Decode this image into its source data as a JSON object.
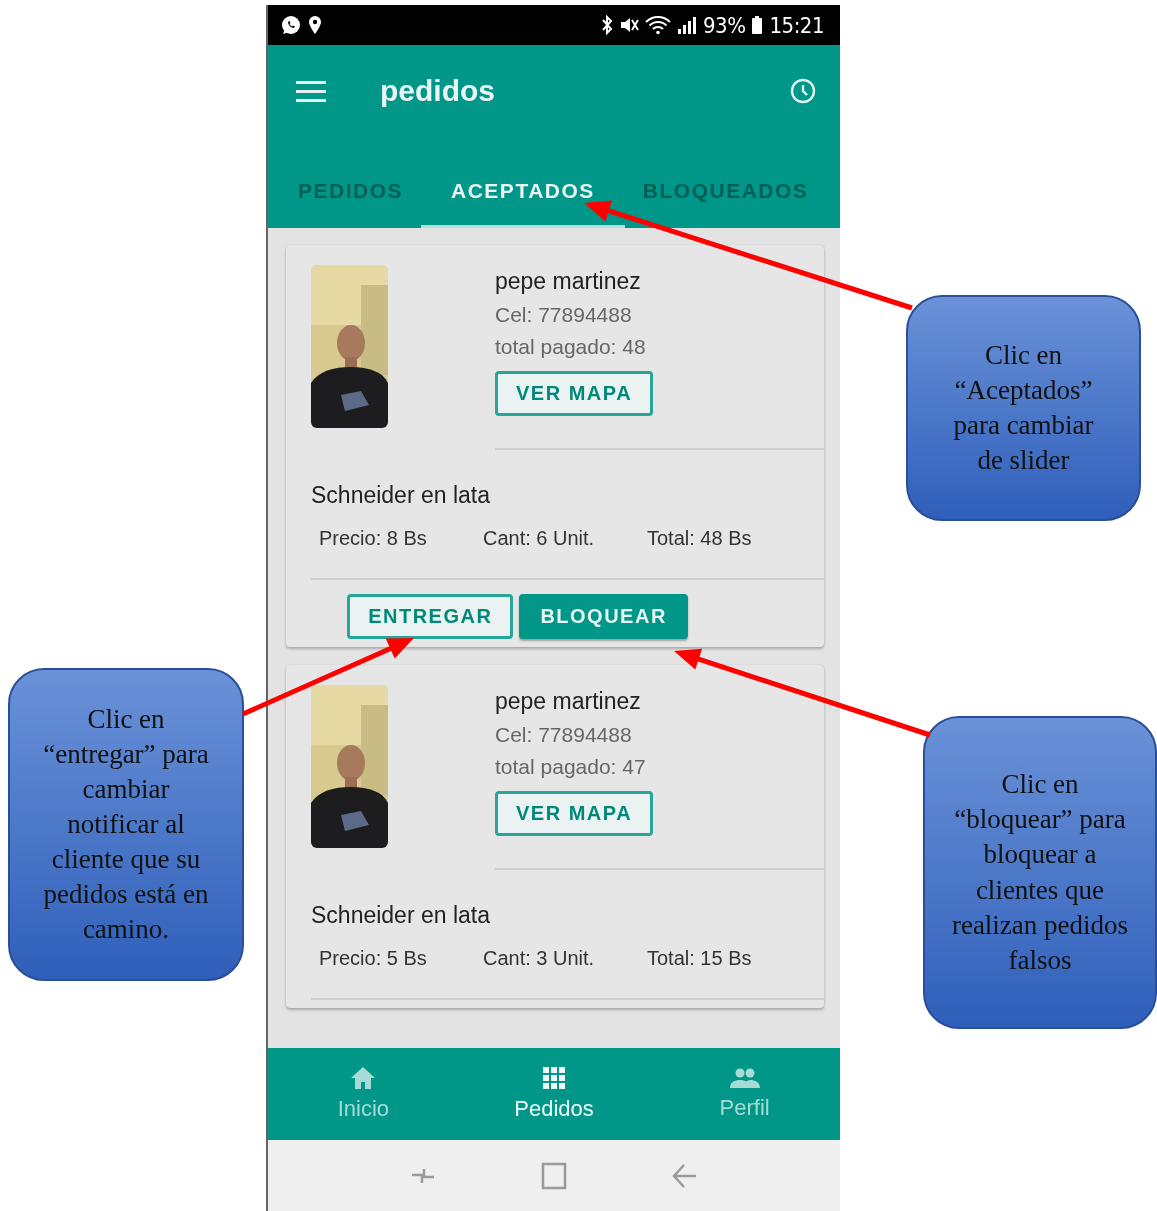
{
  "status_bar": {
    "battery": "93%",
    "time": "15:21"
  },
  "app_bar": {
    "title": "pedidos"
  },
  "tabs": [
    {
      "label": "PEDIDOS",
      "selected": false
    },
    {
      "label": "ACEPTADOS",
      "selected": true
    },
    {
      "label": "BLOQUEADOS",
      "selected": false
    }
  ],
  "orders": [
    {
      "name": "pepe martinez",
      "phone": "Cel: 77894488",
      "paid": "total pagado: 48",
      "map_button": "VER MAPA",
      "items": [
        {
          "product": "Schneider en lata",
          "price": "Precio: 8 Bs",
          "qty": "Cant: 6 Unit.",
          "total": "Total: 48 Bs"
        }
      ],
      "actions": [
        {
          "label": "ENTREGAR",
          "kind": "outlined"
        },
        {
          "label": "BLOQUEAR",
          "kind": "filled"
        }
      ]
    },
    {
      "name": "pepe martinez",
      "phone": "Cel: 77894488",
      "paid": "total pagado: 47",
      "map_button": "VER MAPA",
      "items": [
        {
          "product": "Schneider en lata",
          "price": "Precio: 5 Bs",
          "qty": "Cant: 3 Unit.",
          "total": "Total: 15 Bs"
        }
      ]
    }
  ],
  "bottom_nav": [
    {
      "label": "Inicio",
      "kind": "home",
      "selected": false
    },
    {
      "label": "Pedidos",
      "kind": "grid",
      "selected": true
    },
    {
      "label": "Perfil",
      "kind": "people",
      "selected": false
    }
  ],
  "callouts": [
    {
      "text": "Clic en “Aceptados” para cambiar de slider"
    },
    {
      "text": "Clic en “entregar” para cambiar notificar al cliente que su pedidos está en camino."
    },
    {
      "text": "Clic en “bloquear” para bloquear a clientes que realizan pedidos falsos"
    }
  ]
}
